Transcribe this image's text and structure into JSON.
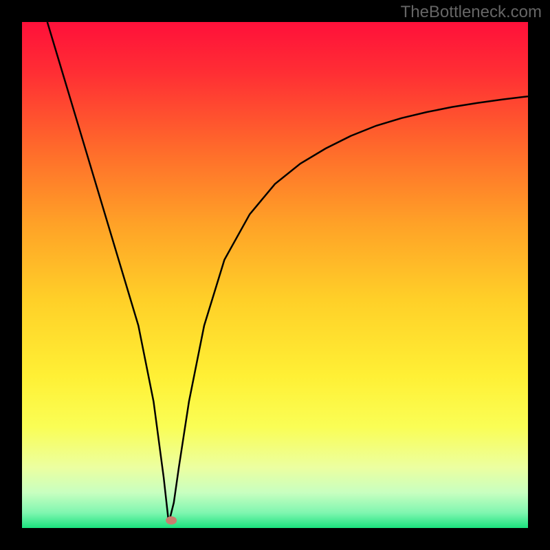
{
  "watermark_text": "TheBottleneck.com",
  "chart_data": {
    "type": "line",
    "title": "",
    "xlabel": "",
    "ylabel": "",
    "xlim": [
      0,
      100
    ],
    "ylim": [
      0,
      100
    ],
    "grid": false,
    "legend": false,
    "curve_min_x": 29,
    "marker": {
      "x": 29.5,
      "y": 1.5,
      "color": "#c97f6f"
    },
    "series": [
      {
        "name": "bottleneck-curve",
        "color": "#000000",
        "x": [
          5,
          8,
          11,
          14,
          17,
          20,
          23,
          26,
          28,
          29,
          30,
          31,
          33,
          36,
          40,
          45,
          50,
          55,
          60,
          65,
          70,
          75,
          80,
          85,
          90,
          95,
          100
        ],
        "values": [
          100,
          90,
          80,
          70,
          60,
          50,
          40,
          25,
          10,
          1,
          5,
          12,
          25,
          40,
          53,
          62,
          68,
          72,
          75,
          77.5,
          79.5,
          81,
          82.2,
          83.2,
          84,
          84.7,
          85.3
        ]
      }
    ],
    "background_gradient_stops": [
      {
        "offset": 0.0,
        "color": "#ff103a"
      },
      {
        "offset": 0.1,
        "color": "#ff2e34"
      },
      {
        "offset": 0.25,
        "color": "#ff6a2b"
      },
      {
        "offset": 0.4,
        "color": "#ffa227"
      },
      {
        "offset": 0.55,
        "color": "#ffd028"
      },
      {
        "offset": 0.7,
        "color": "#fff035"
      },
      {
        "offset": 0.8,
        "color": "#fafe55"
      },
      {
        "offset": 0.88,
        "color": "#ecffa0"
      },
      {
        "offset": 0.93,
        "color": "#c8ffc0"
      },
      {
        "offset": 0.97,
        "color": "#7ff6b0"
      },
      {
        "offset": 1.0,
        "color": "#1be27e"
      }
    ]
  }
}
